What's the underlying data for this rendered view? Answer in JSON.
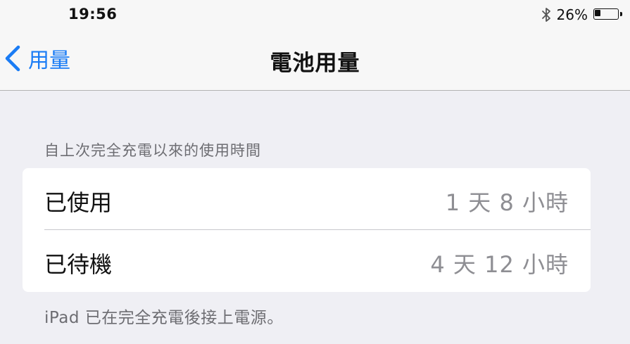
{
  "status_bar": {
    "time": "19:56",
    "bluetooth_icon": "bluetooth-icon",
    "battery_percent": "26%",
    "battery_level": 0.26
  },
  "nav": {
    "back_label": "用量",
    "back_icon": "chevron-left-icon",
    "title": "電池用量"
  },
  "section": {
    "header": "自上次完全充電以來的使用時間",
    "rows": [
      {
        "label": "已使用",
        "value": "1 天 8 小時"
      },
      {
        "label": "已待機",
        "value": "4 天 12 小時"
      }
    ],
    "footer": "iPad 已在完全充電後接上電源。"
  },
  "colors": {
    "accent": "#1a7cf5",
    "background": "#efeff4",
    "secondary_text": "#8e8e93"
  }
}
